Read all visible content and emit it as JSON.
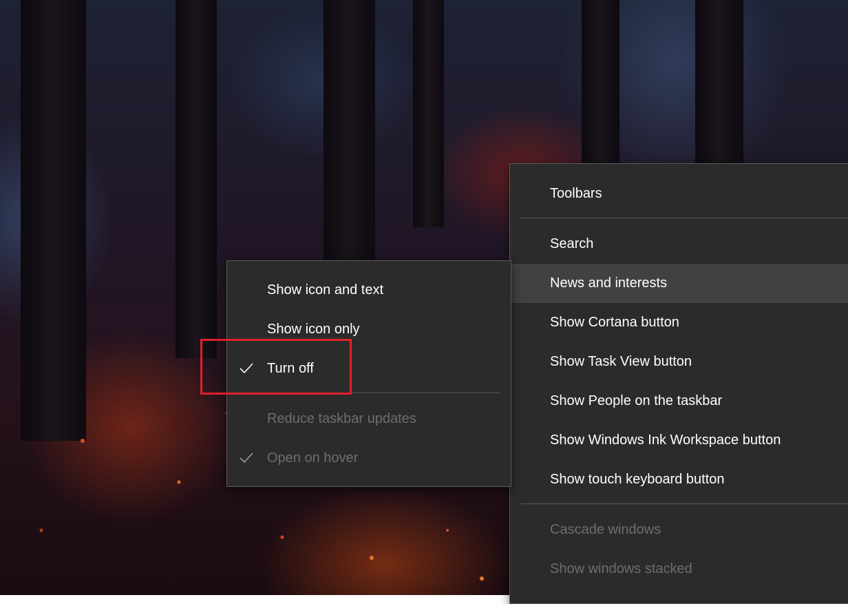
{
  "taskbar_menu": {
    "items": [
      {
        "label": "Toolbars",
        "disabled": false
      },
      {
        "label": "Search",
        "disabled": false
      },
      {
        "label": "News and interests",
        "disabled": false
      },
      {
        "label": "Show Cortana button",
        "disabled": false
      },
      {
        "label": "Show Task View button",
        "disabled": false
      },
      {
        "label": "Show People on the taskbar",
        "disabled": false
      },
      {
        "label": "Show Windows Ink Workspace button",
        "disabled": false
      },
      {
        "label": "Show touch keyboard button",
        "disabled": false
      },
      {
        "label": "Cascade windows",
        "disabled": true
      },
      {
        "label": "Show windows stacked",
        "disabled": true
      }
    ]
  },
  "news_menu": {
    "items": [
      {
        "label": "Show icon and text",
        "checked": false,
        "disabled": false
      },
      {
        "label": "Show icon only",
        "checked": false,
        "disabled": false
      },
      {
        "label": "Turn off",
        "checked": true,
        "disabled": false
      },
      {
        "label": "Reduce taskbar updates",
        "checked": false,
        "disabled": true
      },
      {
        "label": "Open on hover",
        "checked": true,
        "disabled": true
      }
    ]
  },
  "colors": {
    "menu_background": "#2b2b2b",
    "hover_background": "#414141",
    "highlight_outline": "#e0202a",
    "disabled_text": "#6d6d6d"
  }
}
